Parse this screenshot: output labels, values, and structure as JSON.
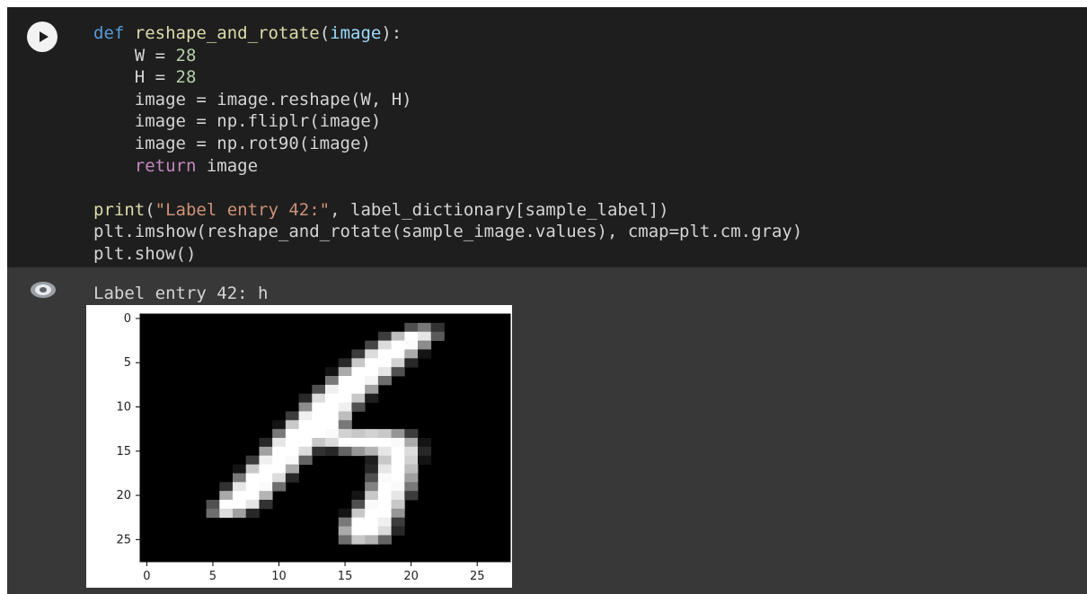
{
  "notebook": {
    "run_button_label": "Run cell",
    "code_lines": {
      "l1_def": "def",
      "l1_name": "reshape_and_rotate",
      "l1_open": "(",
      "l1_param": "image",
      "l1_close": "):",
      "l2": "    W = ",
      "l2_num": "28",
      "l3": "    H = ",
      "l3_num": "28",
      "l4": "    image = image.reshape(W, H)",
      "l5": "    image = np.fliplr(image)",
      "l6": "    image = np.rot90(image)",
      "l7_kw": "return",
      "l7_rest": " image",
      "l9_fn": "print",
      "l9_open": "(",
      "l9_str": "\"Label entry 42:\"",
      "l9_rest": ", label_dictionary[sample_label])",
      "l10": "plt.imshow(reshape_and_rotate(sample_image.values), cmap=plt.cm.gray)",
      "l11": "plt.show()"
    },
    "output": {
      "stdout": "Label entry 42: h"
    },
    "colors": {
      "cell_bg": "#1e1e1e",
      "output_bg": "#383838",
      "keyword": "#569cd6",
      "return_keyword": "#c586c0",
      "number": "#b5cea8",
      "string": "#ce9178"
    }
  },
  "chart_data": {
    "type": "heatmap",
    "cmap": "gray",
    "title": "",
    "xlabel": "",
    "ylabel": "",
    "xlim": [
      0,
      27
    ],
    "ylim": [
      27,
      0
    ],
    "x_ticks": [
      "0",
      "5",
      "10",
      "15",
      "20",
      "25"
    ],
    "y_ticks": [
      "0",
      "5",
      "10",
      "15",
      "20",
      "25"
    ],
    "description_of_pixels": "28x28 grayscale handwritten letter h, white strokes on black",
    "pixels": [
      [
        0,
        0,
        0,
        0,
        0,
        0,
        0,
        0,
        0,
        0,
        0,
        0,
        0,
        0,
        0,
        0,
        0,
        0,
        0,
        0,
        0,
        0,
        0,
        0,
        0,
        0,
        0,
        0
      ],
      [
        0,
        0,
        0,
        0,
        0,
        0,
        0,
        0,
        0,
        0,
        0,
        0,
        0,
        0,
        0,
        0,
        0,
        0,
        0,
        0,
        80,
        120,
        50,
        0,
        0,
        0,
        0,
        0
      ],
      [
        0,
        0,
        0,
        0,
        0,
        0,
        0,
        0,
        0,
        0,
        0,
        0,
        0,
        0,
        0,
        0,
        0,
        0,
        60,
        190,
        255,
        230,
        90,
        0,
        0,
        0,
        0,
        0
      ],
      [
        0,
        0,
        0,
        0,
        0,
        0,
        0,
        0,
        0,
        0,
        0,
        0,
        0,
        0,
        0,
        0,
        0,
        70,
        220,
        255,
        250,
        140,
        0,
        0,
        0,
        0,
        0,
        0
      ],
      [
        0,
        0,
        0,
        0,
        0,
        0,
        0,
        0,
        0,
        0,
        0,
        0,
        0,
        0,
        0,
        0,
        60,
        220,
        255,
        255,
        170,
        20,
        0,
        0,
        0,
        0,
        0,
        0
      ],
      [
        0,
        0,
        0,
        0,
        0,
        0,
        0,
        0,
        0,
        0,
        0,
        0,
        0,
        0,
        0,
        40,
        200,
        255,
        255,
        210,
        40,
        0,
        0,
        0,
        0,
        0,
        0,
        0
      ],
      [
        0,
        0,
        0,
        0,
        0,
        0,
        0,
        0,
        0,
        0,
        0,
        0,
        0,
        0,
        20,
        170,
        255,
        255,
        230,
        80,
        0,
        0,
        0,
        0,
        0,
        0,
        0,
        0
      ],
      [
        0,
        0,
        0,
        0,
        0,
        0,
        0,
        0,
        0,
        0,
        0,
        0,
        0,
        0,
        120,
        255,
        255,
        245,
        110,
        0,
        0,
        0,
        0,
        0,
        0,
        0,
        0,
        0
      ],
      [
        0,
        0,
        0,
        0,
        0,
        0,
        0,
        0,
        0,
        0,
        0,
        0,
        0,
        80,
        240,
        255,
        255,
        160,
        0,
        0,
        0,
        0,
        0,
        0,
        0,
        0,
        0,
        0
      ],
      [
        0,
        0,
        0,
        0,
        0,
        0,
        0,
        0,
        0,
        0,
        0,
        0,
        40,
        220,
        255,
        255,
        200,
        30,
        0,
        0,
        0,
        0,
        0,
        0,
        0,
        0,
        0,
        0
      ],
      [
        0,
        0,
        0,
        0,
        0,
        0,
        0,
        0,
        0,
        0,
        0,
        0,
        140,
        255,
        255,
        240,
        80,
        0,
        0,
        0,
        0,
        0,
        0,
        0,
        0,
        0,
        0,
        0
      ],
      [
        0,
        0,
        0,
        0,
        0,
        0,
        0,
        0,
        0,
        0,
        0,
        60,
        240,
        255,
        255,
        190,
        0,
        0,
        0,
        0,
        0,
        0,
        0,
        0,
        0,
        0,
        0,
        0
      ],
      [
        0,
        0,
        0,
        0,
        0,
        0,
        0,
        0,
        0,
        0,
        20,
        200,
        255,
        255,
        255,
        120,
        0,
        0,
        0,
        0,
        0,
        0,
        0,
        0,
        0,
        0,
        0,
        0
      ],
      [
        0,
        0,
        0,
        0,
        0,
        0,
        0,
        0,
        0,
        0,
        120,
        255,
        255,
        255,
        250,
        210,
        200,
        210,
        200,
        150,
        60,
        0,
        0,
        0,
        0,
        0,
        0,
        0
      ],
      [
        0,
        0,
        0,
        0,
        0,
        0,
        0,
        0,
        0,
        40,
        230,
        255,
        255,
        200,
        220,
        255,
        255,
        255,
        255,
        250,
        170,
        20,
        0,
        0,
        0,
        0,
        0,
        0
      ],
      [
        0,
        0,
        0,
        0,
        0,
        0,
        0,
        0,
        0,
        160,
        255,
        255,
        220,
        50,
        40,
        100,
        150,
        180,
        230,
        255,
        220,
        40,
        0,
        0,
        0,
        0,
        0,
        0
      ],
      [
        0,
        0,
        0,
        0,
        0,
        0,
        0,
        0,
        60,
        240,
        255,
        250,
        100,
        0,
        0,
        0,
        0,
        30,
        200,
        255,
        210,
        20,
        0,
        0,
        0,
        0,
        0,
        0
      ],
      [
        0,
        0,
        0,
        0,
        0,
        0,
        0,
        20,
        200,
        255,
        255,
        170,
        0,
        0,
        0,
        0,
        0,
        40,
        230,
        255,
        190,
        0,
        0,
        0,
        0,
        0,
        0,
        0
      ],
      [
        0,
        0,
        0,
        0,
        0,
        0,
        0,
        120,
        255,
        255,
        220,
        40,
        0,
        0,
        0,
        0,
        0,
        80,
        250,
        255,
        160,
        0,
        0,
        0,
        0,
        0,
        0,
        0
      ],
      [
        0,
        0,
        0,
        0,
        0,
        0,
        50,
        230,
        255,
        250,
        110,
        0,
        0,
        0,
        0,
        0,
        0,
        130,
        255,
        250,
        120,
        0,
        0,
        0,
        0,
        0,
        0,
        0
      ],
      [
        0,
        0,
        0,
        0,
        0,
        0,
        170,
        255,
        255,
        180,
        0,
        0,
        0,
        0,
        0,
        0,
        20,
        200,
        255,
        230,
        60,
        0,
        0,
        0,
        0,
        0,
        0,
        0
      ],
      [
        0,
        0,
        0,
        0,
        0,
        80,
        255,
        255,
        230,
        50,
        0,
        0,
        0,
        0,
        0,
        0,
        80,
        250,
        255,
        200,
        0,
        0,
        0,
        0,
        0,
        0,
        0,
        0
      ],
      [
        0,
        0,
        0,
        0,
        0,
        110,
        220,
        160,
        40,
        0,
        0,
        0,
        0,
        0,
        0,
        20,
        200,
        255,
        255,
        150,
        0,
        0,
        0,
        0,
        0,
        0,
        0,
        0
      ],
      [
        0,
        0,
        0,
        0,
        0,
        0,
        0,
        0,
        0,
        0,
        0,
        0,
        0,
        0,
        0,
        120,
        255,
        255,
        240,
        60,
        0,
        0,
        0,
        0,
        0,
        0,
        0,
        0
      ],
      [
        0,
        0,
        0,
        0,
        0,
        0,
        0,
        0,
        0,
        0,
        0,
        0,
        0,
        0,
        0,
        170,
        255,
        255,
        220,
        40,
        0,
        0,
        0,
        0,
        0,
        0,
        0,
        0
      ],
      [
        0,
        0,
        0,
        0,
        0,
        0,
        0,
        0,
        0,
        0,
        0,
        0,
        0,
        0,
        0,
        110,
        200,
        180,
        100,
        0,
        0,
        0,
        0,
        0,
        0,
        0,
        0,
        0
      ],
      [
        0,
        0,
        0,
        0,
        0,
        0,
        0,
        0,
        0,
        0,
        0,
        0,
        0,
        0,
        0,
        0,
        0,
        0,
        0,
        0,
        0,
        0,
        0,
        0,
        0,
        0,
        0,
        0
      ],
      [
        0,
        0,
        0,
        0,
        0,
        0,
        0,
        0,
        0,
        0,
        0,
        0,
        0,
        0,
        0,
        0,
        0,
        0,
        0,
        0,
        0,
        0,
        0,
        0,
        0,
        0,
        0,
        0
      ]
    ]
  }
}
